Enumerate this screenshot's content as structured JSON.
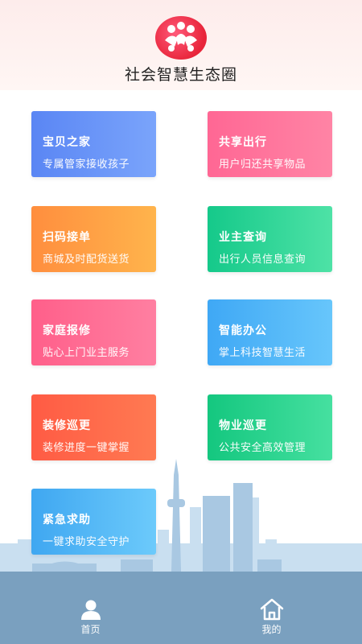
{
  "header": {
    "app_title": "社会智慧生态圈",
    "logo_icon": "people-circle-logo"
  },
  "cards": [
    {
      "title": "宝贝之家",
      "subtitle": "专属管家接收孩子",
      "color": "#5a86f4"
    },
    {
      "title": "共享出行",
      "subtitle": "用户归还共享物品",
      "color": "#ff6794"
    },
    {
      "title": "扫码接单",
      "subtitle": "商城及时配货送货",
      "color": "#ff8e3e"
    },
    {
      "title": "业主查询",
      "subtitle": "出行人员信息查询",
      "color": "#15c98a"
    },
    {
      "title": "家庭报修",
      "subtitle": "贴心上门业主服务",
      "color": "#ff5f8a"
    },
    {
      "title": "智能办公",
      "subtitle": "掌上科技智慧生活",
      "color": "#3fa8f5"
    },
    {
      "title": "装修巡更",
      "subtitle": "装修进度一键掌握",
      "color": "#ff5b44"
    },
    {
      "title": "物业巡更",
      "subtitle": "公共安全高效管理",
      "color": "#14c77f"
    },
    {
      "title": "紧急求助",
      "subtitle": "一键求助安全守护",
      "color": "#3fa7f1"
    }
  ],
  "tabbar": {
    "home_label": "首页",
    "home_icon": "user-icon",
    "mine_label": "我的",
    "mine_icon": "house-icon",
    "background": "#7aa0bf"
  }
}
